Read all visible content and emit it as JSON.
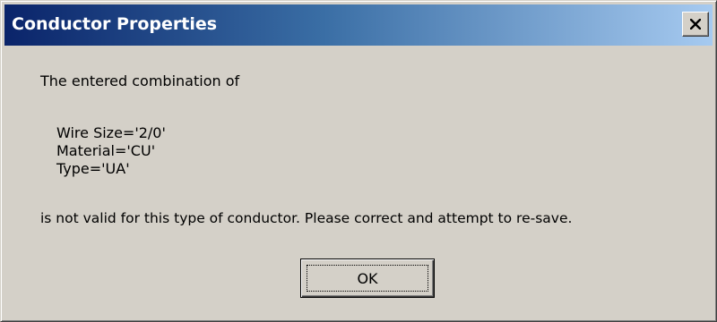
{
  "dialog": {
    "title": "Conductor Properties",
    "close_icon": "close-icon",
    "message_intro": "The entered combination of",
    "details": [
      "Wire Size='2/0'",
      "Material='CU'",
      "Type='UA'"
    ],
    "message_outro": "is not valid for this type of conductor. Please correct and attempt to re-save.",
    "ok_label": "OK"
  },
  "colors": {
    "titlebar_start": "#0a246a",
    "titlebar_end": "#a6caf0",
    "face": "#d4d0c8"
  }
}
